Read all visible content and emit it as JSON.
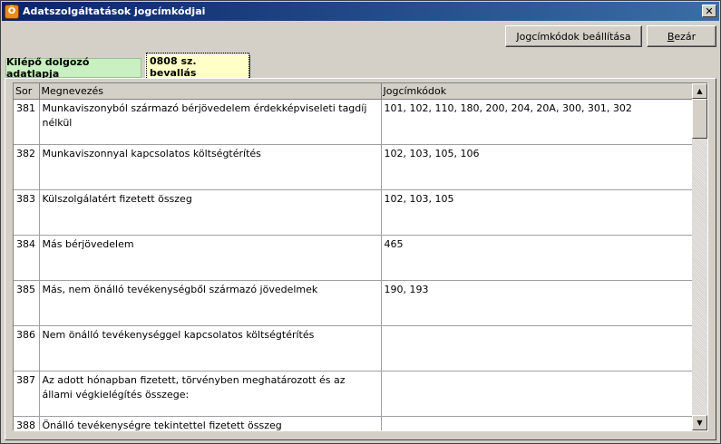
{
  "window": {
    "title": "Adatszolgáltatások jogcímkódjai",
    "icon_letter": "Ö",
    "close_label": "✕"
  },
  "toolbar": {
    "settings_label": "Jogcímkódok beállítása",
    "close_label": "Bezár"
  },
  "tabs": [
    {
      "label": "Kilépő dolgozó adatlapja",
      "active": false
    },
    {
      "label": "0808 sz. bevallás",
      "active": true
    }
  ],
  "table": {
    "headers": [
      "Sor",
      "Megnevezés",
      "Jogcímkódok"
    ],
    "rows": [
      {
        "sor": "381",
        "name": "Munkaviszonyból származó bérjövedelem érdekképviseleti tagdíj nélkül",
        "codes": "101, 102, 110, 180, 200, 204, 20A, 300, 301, 302"
      },
      {
        "sor": "382",
        "name": "Munkaviszonnyal kapcsolatos költségtérítés",
        "codes": "102, 103, 105, 106"
      },
      {
        "sor": "383",
        "name": "Külszolgálatért fizetett összeg",
        "codes": "102, 103, 105"
      },
      {
        "sor": "384",
        "name": "Más bérjövedelem",
        "codes": "465"
      },
      {
        "sor": "385",
        "name": "Más, nem önálló tevékenységből származó jövedelmek",
        "codes": "190, 193"
      },
      {
        "sor": "386",
        "name": "Nem önálló tevékenységgel kapcsolatos költségtérítés",
        "codes": ""
      },
      {
        "sor": "387",
        "name": "Az adott hónapban fizetett, törvényben meghatározott és az állami végkielégítés összege:",
        "codes": ""
      },
      {
        "sor": "388",
        "name": "Önálló tevékenységre tekintettel fizetett összeg",
        "codes": ""
      }
    ]
  },
  "scrollbar": {
    "up_icon": "▲",
    "down_icon": "▼"
  }
}
